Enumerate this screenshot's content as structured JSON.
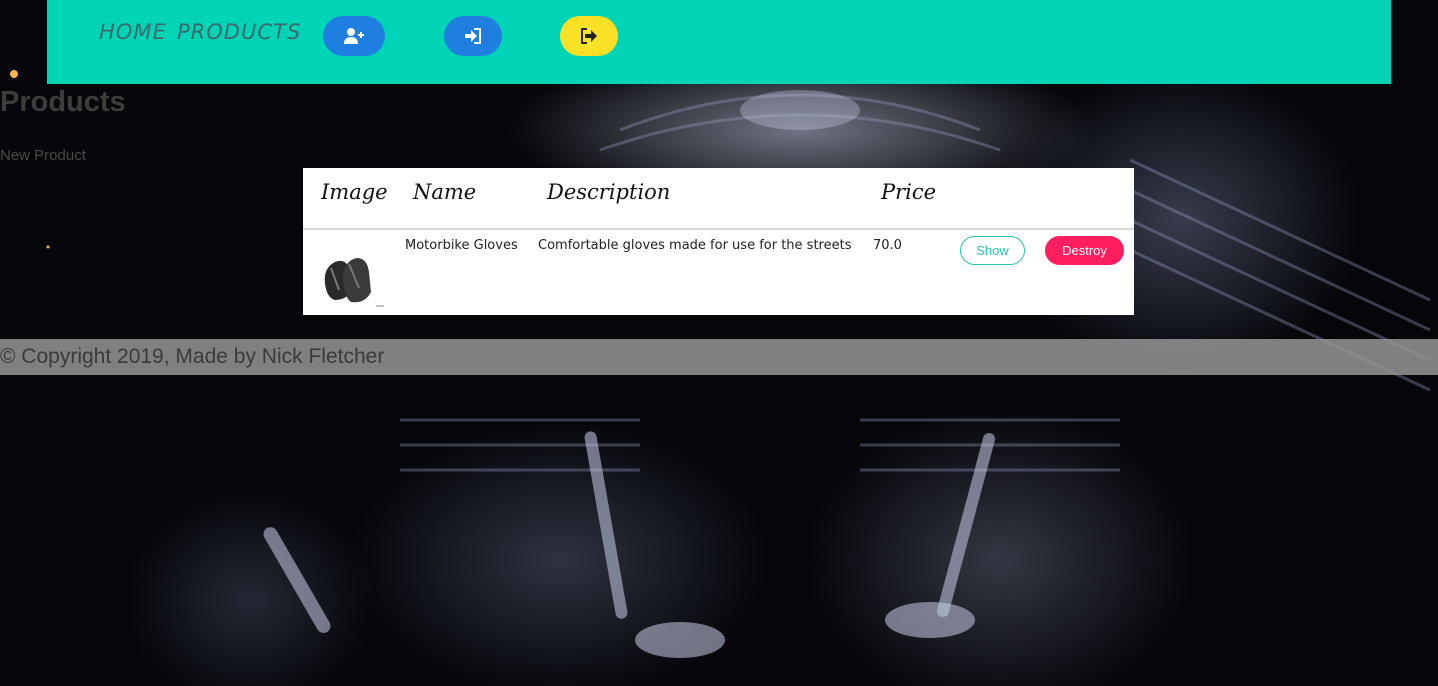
{
  "nav": {
    "home_label": "HOME",
    "products_label": "PRODUCTS",
    "signup_icon": "user-plus-icon",
    "login_icon": "sign-in-icon",
    "logout_icon": "sign-out-icon"
  },
  "page": {
    "title": "Products",
    "new_link": "New Product"
  },
  "table": {
    "headers": [
      "Image",
      "Name",
      "Description",
      "Price"
    ],
    "rows": [
      {
        "name": "Motorbike Gloves",
        "description": "Comfortable gloves made for use for the streets",
        "price": "70.0",
        "show_label": "Show",
        "destroy_label": "Destroy"
      }
    ]
  },
  "footer": {
    "text": "© Copyright 2019, Made by Nick Fletcher"
  },
  "colors": {
    "navbar": "#00d4b7",
    "primary_button": "#1f7fe0",
    "logout_button": "#fbe125",
    "show_outline": "#27c3b1",
    "destroy_button": "#ff1f5e"
  }
}
